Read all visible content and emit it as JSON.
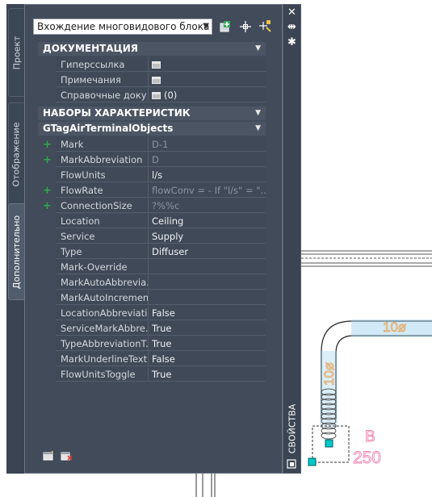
{
  "colors": {
    "panel_bg": "#414b59",
    "add_indicator": "#2ea84a",
    "drawing_label": "#ee7fae",
    "duct_dimension": "#e6a862",
    "grip": "#00c8c8"
  },
  "side_tabs": [
    {
      "label": "Проект"
    },
    {
      "label": "Отображение"
    },
    {
      "label": "Дополнительно",
      "active": true
    }
  ],
  "titlebar": {
    "title": "СВОЙСТВА",
    "close_icon": "close-icon",
    "autohide_icon": "autohide-icon",
    "settings_icon": "settings-icon"
  },
  "selector": {
    "value": "Вхождение многовидового блока"
  },
  "toolbar_icons": [
    "add-to-selection-icon",
    "pick-point-icon",
    "quick-select-icon"
  ],
  "documentation": {
    "header": "ДОКУМЕНТАЦИЯ",
    "rows": [
      {
        "name": "Гиперссылка",
        "value": ""
      },
      {
        "name": "Примечания",
        "value": ""
      },
      {
        "name": "Справочные доку...",
        "value": "(0)"
      }
    ]
  },
  "property_sets": {
    "header": "НАБОРЫ ХАРАКТЕРИСТИК",
    "subheader": "GTagAirTerminalObjects",
    "rows": [
      {
        "name": "Mark",
        "value": "D-1",
        "readonly": true,
        "plus": true
      },
      {
        "name": "MarkAbbreviation",
        "value": "D",
        "readonly": true,
        "plus": true
      },
      {
        "name": "FlowUnits",
        "value": "l/s",
        "readonly": false,
        "plus": false
      },
      {
        "name": "FlowRate",
        "value": "flowConv = - If \"l/s\" = \"...",
        "readonly": true,
        "plus": true
      },
      {
        "name": "ConnectionSize",
        "value": "?%%c",
        "readonly": true,
        "plus": true
      },
      {
        "name": "Location",
        "value": "Ceiling",
        "readonly": false,
        "plus": false
      },
      {
        "name": "Service",
        "value": "Supply",
        "readonly": false,
        "plus": false
      },
      {
        "name": "Type",
        "value": "Diffuser",
        "readonly": false,
        "plus": false
      },
      {
        "name": "Mark-Override",
        "value": "",
        "readonly": false,
        "plus": false
      },
      {
        "name": "MarkAutoAbbrevia...",
        "value": "",
        "readonly": false,
        "plus": false
      },
      {
        "name": "MarkAutoIncremen...",
        "value": "",
        "readonly": false,
        "plus": false
      },
      {
        "name": "LocationAbbreviati...",
        "value": "False",
        "readonly": false,
        "plus": false
      },
      {
        "name": "ServiceMarkAbbre...",
        "value": "True",
        "readonly": false,
        "plus": false
      },
      {
        "name": "TypeAbbreviationT...",
        "value": "True",
        "readonly": false,
        "plus": false
      },
      {
        "name": "MarkUnderlineText...",
        "value": "False",
        "readonly": false,
        "plus": false
      },
      {
        "name": "FlowUnitsToggle",
        "value": "True",
        "readonly": false,
        "plus": false
      }
    ]
  },
  "bottom_icons": [
    "new-property-set-icon",
    "remove-property-set-icon"
  ],
  "drawing": {
    "duct_label_horizontal": "10ø",
    "duct_label_vertical": "10ø",
    "tag_letter": "B",
    "tag_number": "250"
  }
}
